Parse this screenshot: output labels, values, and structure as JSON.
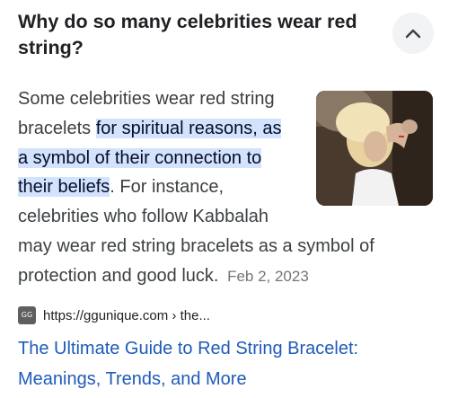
{
  "question": "Why do so many celebrities wear red string?",
  "answer": {
    "text_before": "Some celebrities wear red string bracelets ",
    "highlight": "for spiritual reasons, as a symbol of their connection to their beliefs",
    "text_after": ". For instance, celebrities who follow Kabbalah may wear red string bracelets as a symbol of protection and good luck.",
    "date": "Feb 2, 2023"
  },
  "source": {
    "favicon_icon": "site-favicon-icon",
    "url": "https://ggunique.com › the..."
  },
  "result_title": "The Ultimate Guide to Red String Bracelet: Meanings, Trends, and More",
  "colors": {
    "highlight": "#d3e3fd",
    "link": "#1f5bb8",
    "button_bg": "#f1f3f4"
  }
}
